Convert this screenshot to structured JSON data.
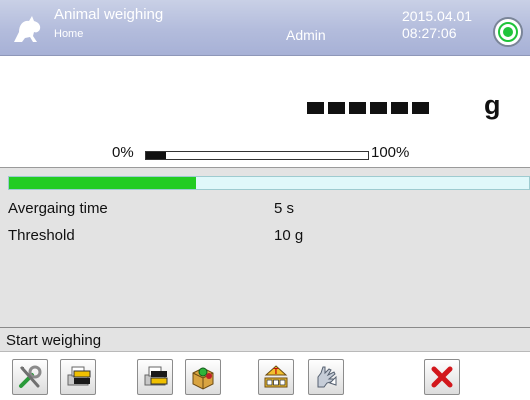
{
  "header": {
    "title": "Animal weighing",
    "subtitle": "Home",
    "user": "Admin",
    "date": "2015.04.01",
    "time": "08:27:06",
    "app_icon": "animal-icon",
    "status_icon": "level-indicator-icon",
    "status_color": "#1fc43a"
  },
  "display": {
    "reading_placeholder": "------",
    "unit": "g",
    "range_min_label": "0%",
    "range_max_label": "100%",
    "range_fill_fraction": 0.09
  },
  "progress": {
    "fill_fraction": 0.36,
    "color": "#22cc22"
  },
  "params": [
    {
      "label": "Avergaing time",
      "value": "5 s"
    },
    {
      "label": "Threshold",
      "value": "10 g"
    }
  ],
  "status_text": "Start weighing",
  "toolbar": {
    "buttons": [
      {
        "name": "settings-button",
        "icon": "tools-icon"
      },
      {
        "name": "printout-header-button",
        "icon": "printout-header-icon"
      },
      {
        "name": "printout-footer-button",
        "icon": "printout-footer-icon"
      },
      {
        "name": "database-button",
        "icon": "database-box-icon"
      },
      {
        "name": "tare-button",
        "icon": "tare-icon"
      },
      {
        "name": "profile-button",
        "icon": "hand-icon"
      },
      {
        "name": "exit-button",
        "icon": "close-icon"
      }
    ]
  }
}
